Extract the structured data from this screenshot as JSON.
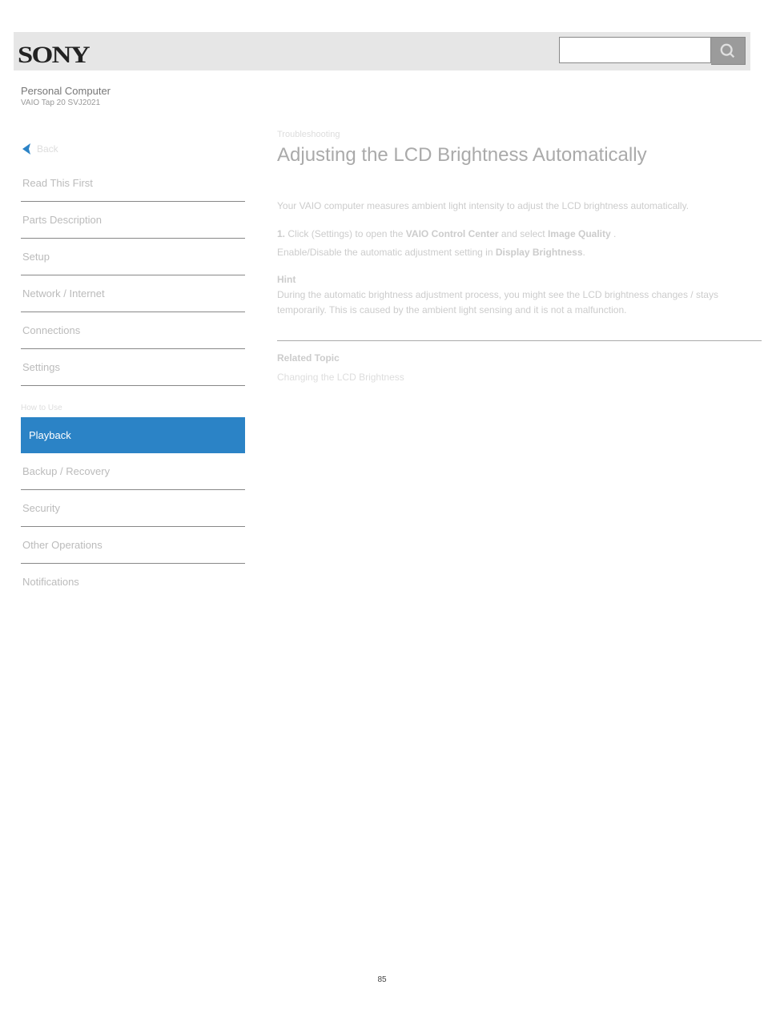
{
  "logo_text": "SONY",
  "product_name": "Personal Computer",
  "model": "VAIO Tap 20 SVJ2021",
  "sidebar": {
    "back_label": "Back",
    "links": [
      "Read This First",
      "Parts Description",
      "Setup",
      "Network / Internet",
      "Connections",
      "Settings"
    ],
    "section_title": "How to Use",
    "buttons": [
      "Playback",
      "Backup / Recovery",
      "Security",
      "Other Operations",
      "Notifications"
    ]
  },
  "main": {
    "breadcrumb": "Troubleshooting",
    "title": "Adjusting the LCD Brightness Automatically",
    "paragraph1": "Your VAIO computer measures ambient light intensity to adjust the LCD brightness automatically.",
    "step_num": "1.",
    "step_text_1": "Click ",
    "step_charm": " (Settings)",
    "step_text_2": " to open the ",
    "step_bold1": "VAIO Control Center",
    "step_text_3": " and select ",
    "step_bold2": "Image Quality",
    "step_text_4": ".",
    "enable_disable": "Enable/Disable the automatic adjustment setting in ",
    "display_brightness": "Display Brightness",
    "hint_label": "Hint",
    "hint_text": "During the automatic brightness adjustment process, you might see the LCD brightness changes / stays temporarily. This is caused by the ambient light sensing and it is not a malfunction.",
    "related_topic_label": "Related Topic",
    "related_link": "Changing the LCD Brightness"
  },
  "page_number": "85"
}
